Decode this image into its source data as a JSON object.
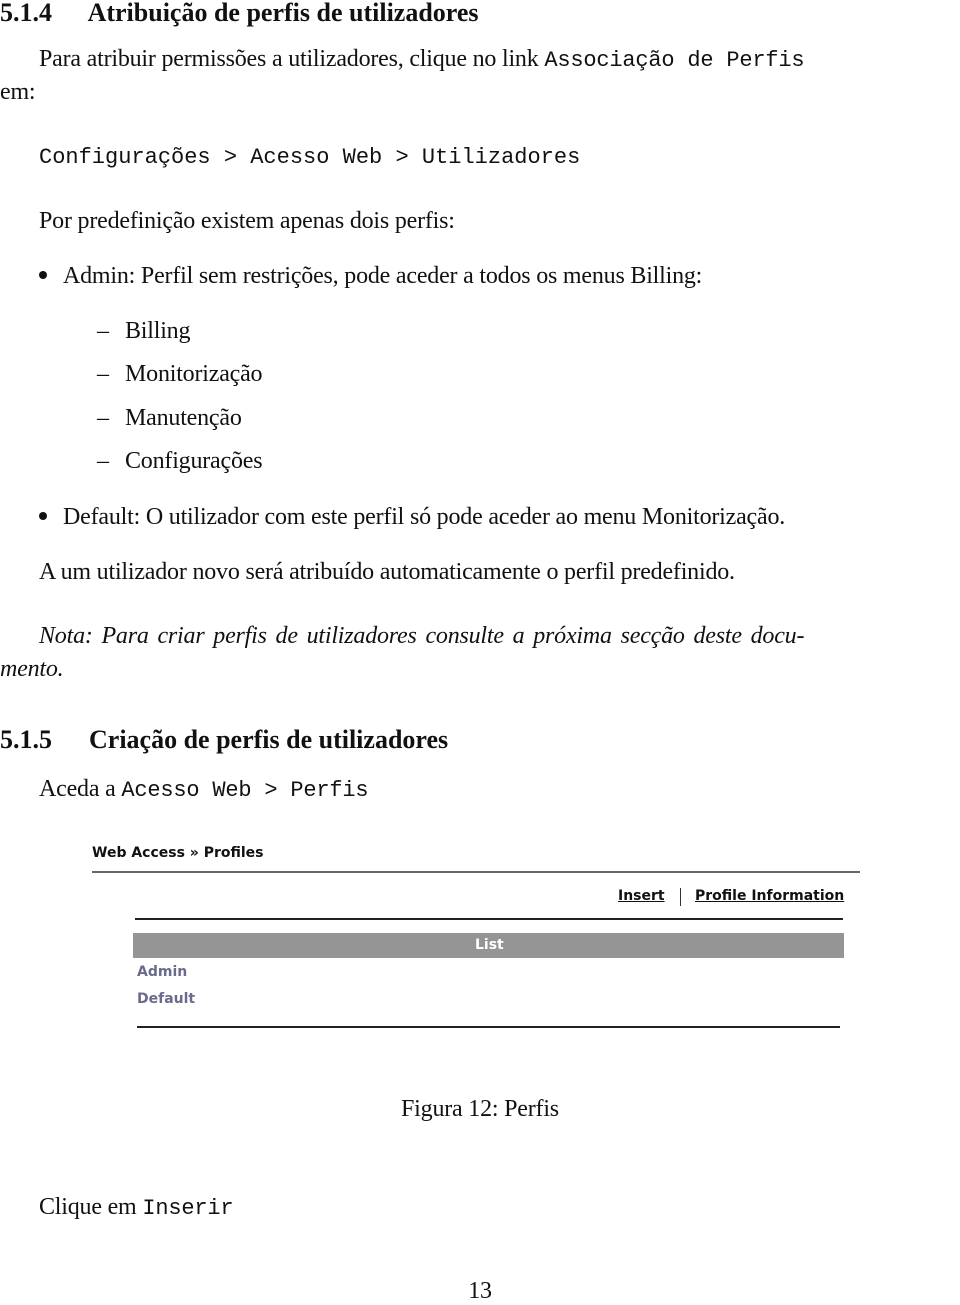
{
  "section_514": {
    "number": "5.1.4",
    "title": "Atribuição de perfis de utilizadores",
    "intro_text": "Para atribuir permissões a utilizadores, clique no link ",
    "intro_code": "Associação de Perfis",
    "intro_cont": "em:",
    "path_code": "Configurações > Acesso Web > Utilizadores",
    "defaults_text": "Por predefinição existem apenas dois perfis:",
    "bullets": [
      {
        "text": "Admin: Perfil sem restrições, pode aceder a todos os menus Billing:",
        "sub": [
          "Billing",
          "Monitorização",
          "Manutenção",
          "Configurações"
        ]
      },
      {
        "text": "Default: O utilizador com este perfil só pode aceder ao menu Monitorização."
      }
    ],
    "auto_text": "A um utilizador novo será atribuído automaticamente o perfil predefinido.",
    "note_line1": "Nota:  Para criar perfis de utilizadores consulte a próxima secção deste docu-",
    "note_line2": "mento."
  },
  "section_515": {
    "number": "5.1.5",
    "title": "Criação de perfis de utilizadores",
    "access_text": "Aceda a ",
    "access_code": "Acesso Web > Perfis"
  },
  "figure": {
    "breadcrumb": "Web Access » Profiles",
    "links": [
      "Insert",
      "Profile Information"
    ],
    "list_header": "List",
    "profiles": [
      "Admin",
      "Default"
    ],
    "caption": "Figura 12: Perfis"
  },
  "after_figure": {
    "text": "Clique em ",
    "code": "Inserir"
  },
  "page_number": "13"
}
